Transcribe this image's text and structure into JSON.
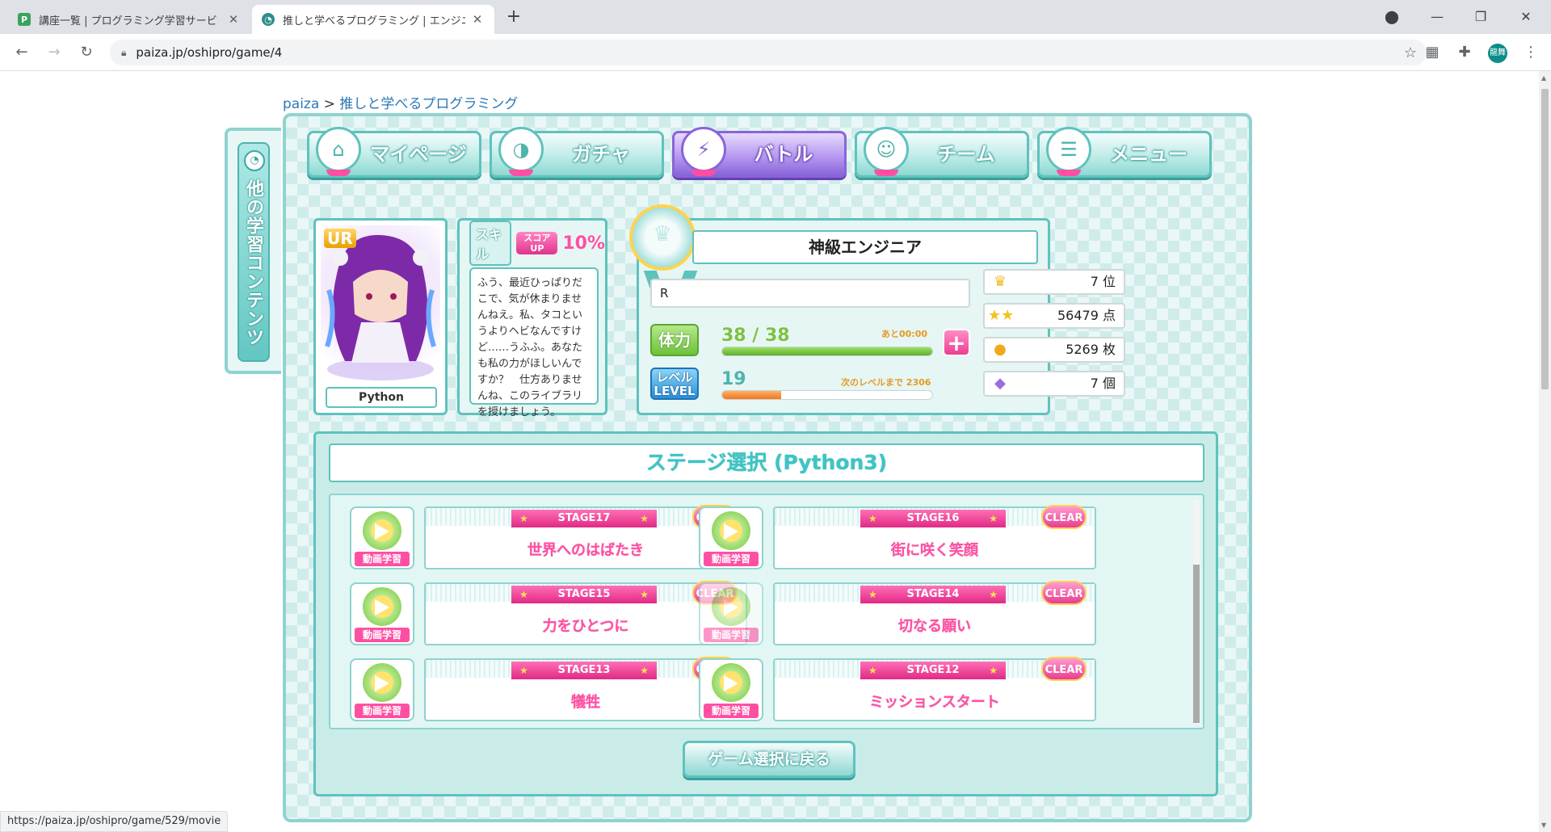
{
  "browser": {
    "tabs": [
      {
        "title": "講座一覧 | プログラミング学習サービ",
        "active": false,
        "favicon": "paiza-icon"
      },
      {
        "title": "推しと学べるプログラミング | エンジニア",
        "active": true,
        "favicon": "oshipro-icon"
      }
    ],
    "url": "paiza.jp/oshipro/game/4",
    "profile_initials": "龍舞",
    "status_url": "https://paiza.jp/oshipro/game/529/movie"
  },
  "breadcrumb": {
    "root": "paiza",
    "sep": ">",
    "current": "推しと学べるプログラミング"
  },
  "sidetab": {
    "label": "他の学習コンテンツ"
  },
  "nav": [
    {
      "label": "マイページ",
      "icon": "house-icon",
      "active": false
    },
    {
      "label": "ガチャ",
      "icon": "capsule-icon",
      "active": false
    },
    {
      "label": "バトル",
      "icon": "battle-icon",
      "active": true
    },
    {
      "label": "チーム",
      "icon": "team-icon",
      "active": false
    },
    {
      "label": "メニュー",
      "icon": "list-icon",
      "active": false
    }
  ],
  "character": {
    "rarity": "UR",
    "name": "Python"
  },
  "skill": {
    "label": "スキル",
    "badge": "スコア UP",
    "percent": "10%",
    "text": "ふう、最近ひっぱりだこで、気が休まりませんねえ。私、タコというよりヘビなんですけど……うふふ。あなたも私の力がほしいんですか？　仕方ありませんね、このライブラリを授けましょう。"
  },
  "status": {
    "rank_title": "神級エンジニア",
    "name": "R",
    "hp_label": "体力",
    "hp_text": "38 / 38",
    "hp_fraction": 1.0,
    "hp_note": "あと00:00",
    "level_label": "レベル LEVEL",
    "level": "19",
    "level_note": "次のレベルまで 2306",
    "level_fraction": 0.28,
    "ranking": "7 位",
    "score": "56479 点",
    "coins": "5269 枚",
    "gems": "7 個"
  },
  "stages": {
    "title": "ステージ選択 (Python3)",
    "movie_label": "動画学習",
    "clear_label": "CLEAR",
    "items": [
      {
        "stage": "STAGE17",
        "name": "世界へのはばたき"
      },
      {
        "stage": "STAGE16",
        "name": "街に咲く笑顔"
      },
      {
        "stage": "STAGE15",
        "name": "力をひとつに"
      },
      {
        "stage": "STAGE14",
        "name": "切なる願い"
      },
      {
        "stage": "STAGE13",
        "name": "犠牲"
      },
      {
        "stage": "STAGE12",
        "name": "ミッションスタート"
      }
    ],
    "back_label": "ゲーム選択に戻る"
  }
}
